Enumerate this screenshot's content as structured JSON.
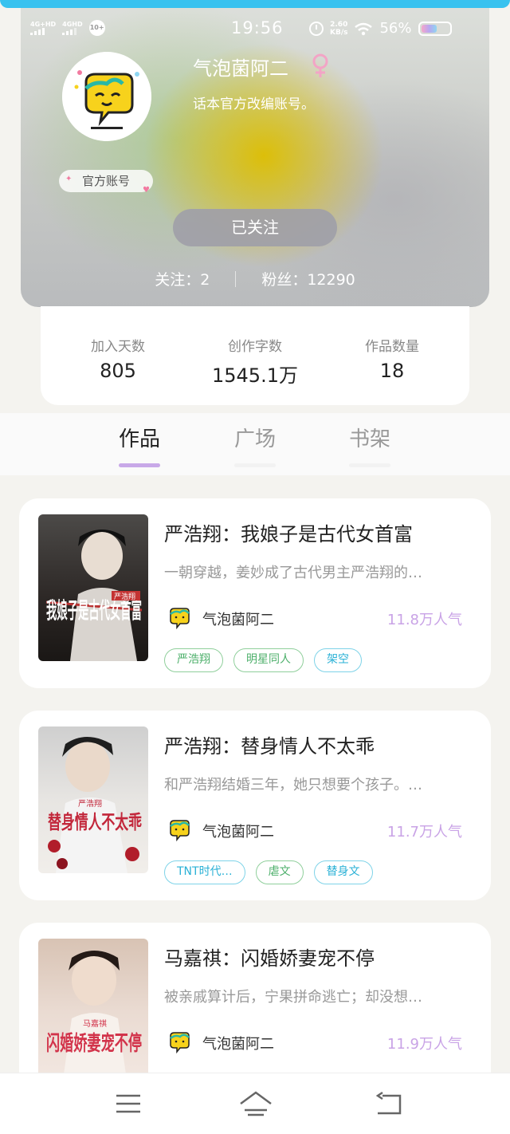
{
  "status_bar": {
    "time": "19:56",
    "network_1": "4G+HD",
    "network_2": "4GHD",
    "badge": "10+",
    "speed_value": "2.60",
    "speed_unit": "KB/s",
    "battery_percent": "56%"
  },
  "profile": {
    "nickname": "气泡菌阿二",
    "gender_icon": "female-icon",
    "bio": "话本官方改编账号。",
    "official_tag": "官方账号",
    "follow_button": "已关注",
    "following_label": "关注：2",
    "fans_label": "粉丝：12290"
  },
  "stats": [
    {
      "label": "加入天数",
      "value": "805"
    },
    {
      "label": "创作字数",
      "value": "1545.1万"
    },
    {
      "label": "作品数量",
      "value": "18"
    }
  ],
  "tabs": [
    {
      "label": "作品",
      "active": true
    },
    {
      "label": "广场",
      "active": false
    },
    {
      "label": "书架",
      "active": false
    }
  ],
  "works": [
    {
      "title": "严浩翔：我娘子是古代女首富",
      "description": "一朝穿越，姜妙成了古代男主严浩翔的…",
      "author": "气泡菌阿二",
      "popularity": "11.8万人气",
      "cover_text": "我娘子是古代女首富",
      "cover_sub": "严浩翔",
      "tags": [
        {
          "label": "严浩翔",
          "color": "green"
        },
        {
          "label": "明星同人",
          "color": "green"
        },
        {
          "label": "架空",
          "color": "cyan"
        }
      ]
    },
    {
      "title": "严浩翔：替身情人不太乖",
      "description": "和严浩翔结婚三年，她只想要个孩子。…",
      "author": "气泡菌阿二",
      "popularity": "11.7万人气",
      "cover_text": "替身情人不太乖",
      "cover_sub": "严浩翔",
      "tags": [
        {
          "label": "TNT时代…",
          "color": "cyan"
        },
        {
          "label": "虐文",
          "color": "green"
        },
        {
          "label": "替身文",
          "color": "cyan"
        }
      ]
    },
    {
      "title": "马嘉祺：闪婚娇妻宠不停",
      "description": "被亲戚算计后，宁果拼命逃亡；却没想…",
      "author": "气泡菌阿二",
      "popularity": "11.9万人气",
      "cover_text": "闪婚娇妻宠不停",
      "cover_sub": "马嘉祺",
      "tags": [
        {
          "label": "",
          "color": "cyan"
        },
        {
          "label": "",
          "color": "red"
        },
        {
          "label": "",
          "color": "cyan"
        }
      ]
    }
  ],
  "colors": {
    "accent_purple": "#c9a3e6",
    "tab_indicator": "#c8a8e8",
    "top_accent": "#38c2ef"
  },
  "nav": {
    "menu_icon": "menu-icon",
    "home_icon": "home-icon",
    "back_icon": "back-icon"
  }
}
